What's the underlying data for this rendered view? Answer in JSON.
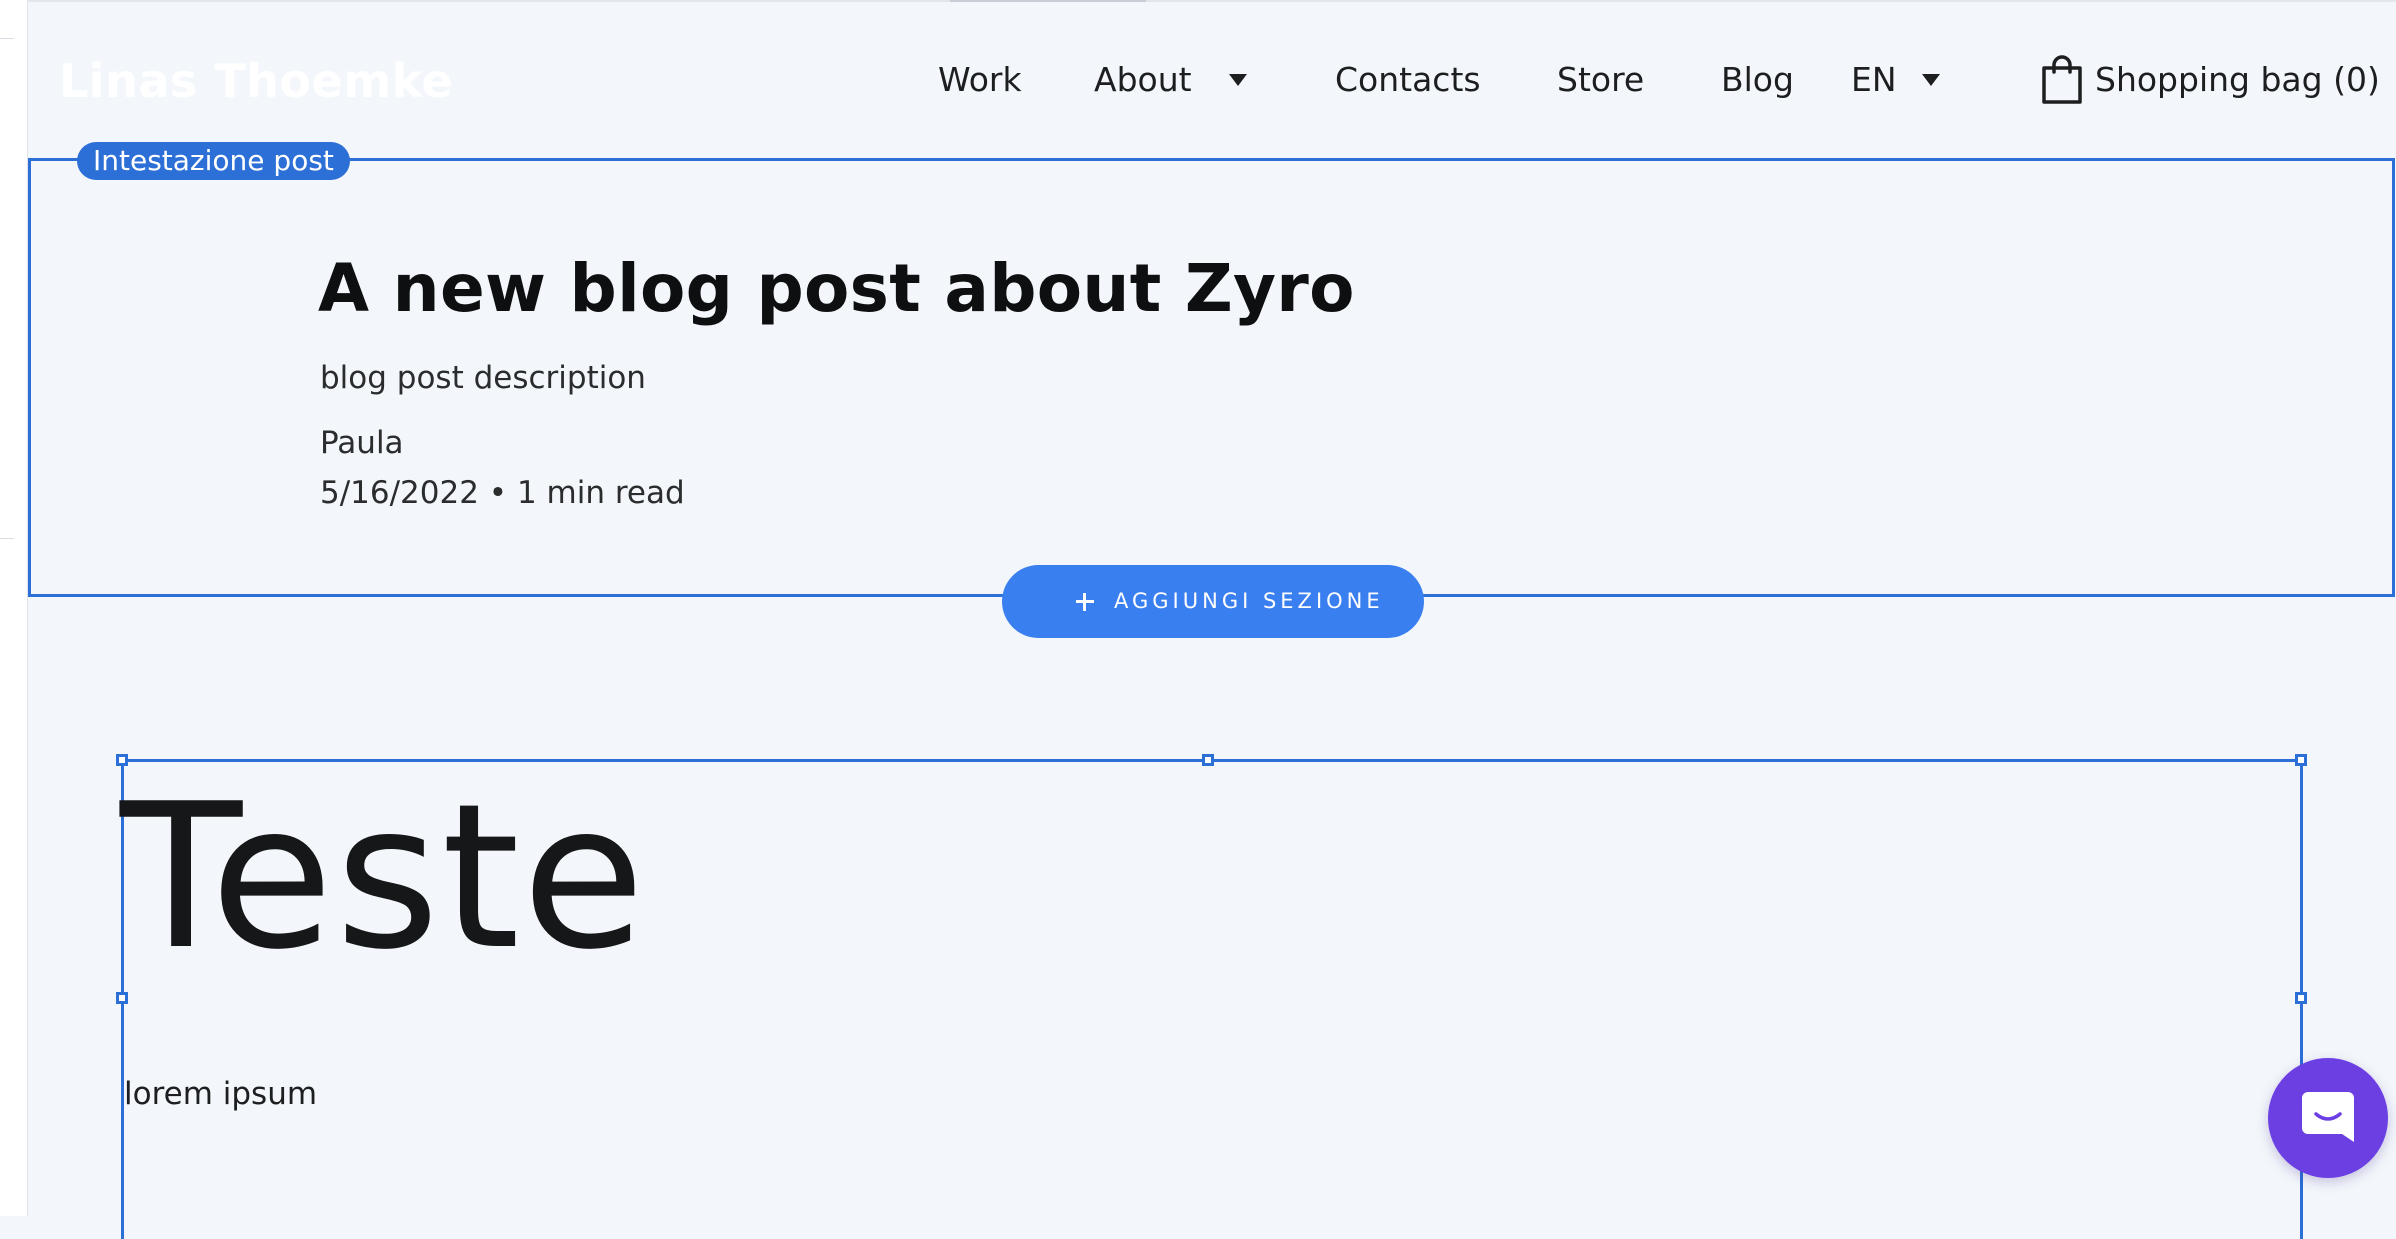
{
  "header": {
    "logo": "Linas Thoemke",
    "nav": {
      "work": "Work",
      "about": "About",
      "contacts": "Contacts",
      "store": "Store",
      "blog": "Blog",
      "language": "EN"
    },
    "shopping_bag": "Shopping bag (0)"
  },
  "post_header": {
    "section_label": "Intestazione post",
    "title": "A new blog post about Zyro",
    "description": "blog post description",
    "author": "Paula",
    "meta": "5/16/2022 • 1 min read"
  },
  "add_section": {
    "label": "AGGIUNGI SEZIONE"
  },
  "content": {
    "heading": "Teste",
    "body": "lorem ipsum"
  },
  "icons": {
    "bag": "shopping-bag-icon",
    "caret": "chevron-down-icon",
    "plus": "plus-icon",
    "chat": "chat-icon"
  },
  "colors": {
    "accent": "#2c6fd6",
    "button": "#3a7ff0",
    "chat": "#6c3fe3",
    "background": "#f3f7fb"
  }
}
